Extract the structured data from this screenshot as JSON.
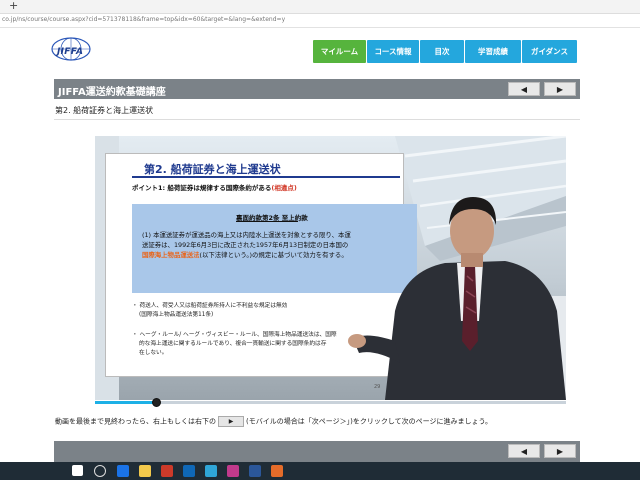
{
  "browser": {
    "new_tab_symbol": "+",
    "url": "co.jp/ns/course/course.aspx?cid=571378118&frame=top&idx=60&target=&lang=&extend=y"
  },
  "logo": {
    "text": "JIFFA"
  },
  "nav": [
    {
      "label": "マイルーム",
      "color": "#56b43d"
    },
    {
      "label": "コース情報",
      "color": "#24a7dd"
    },
    {
      "label": "目次",
      "color": "#24a7dd"
    },
    {
      "label": "学習成績",
      "color": "#24a7dd"
    },
    {
      "label": "ガイダンス",
      "color": "#24a7dd"
    }
  ],
  "course": {
    "title": "JIFFA運送約款基礎講座",
    "prev": "◀",
    "next": "▶"
  },
  "section": {
    "subtitle": "第2. 船荷証券と海上運送状"
  },
  "slide": {
    "heading": "第2. 船荷証券と海上運送状",
    "point_prefix": "ポイント1: 船荷証券は規律する国際条約がある",
    "point_emphasis": "(相違点)",
    "box_heading": "裏面約款第2条 至上約款",
    "box_line1": "(1) 本運送証券が運送品の海上又は内陸水上運送を対象とする限り、本運",
    "box_line2": "送証券は、1992年6月3日に改正された1957年6月13日制定の日本国の",
    "box_line3_orange": "国際海上物品運送法",
    "box_line3_rest": "(以下法律という。)の規定に基づいて効力を有する。",
    "bullet1_line1": "・ 荷送人、荷受人又は船荷証券所持人に不利益な規定は無効",
    "bullet1_line2": "(国際海上物品運送法第11条)",
    "bullet2_line1": "・ ヘーグ・ルール/ ヘーグ・ヴィスビー・ルール、国際海上物品運送法は、国際",
    "bullet2_line2": "的な海上運送に関するルールであり、複合一貫輸送に関する国際条約は存",
    "bullet2_line3": "在しない。",
    "page_number": "29"
  },
  "video": {
    "progress_fraction": 0.13
  },
  "instruction": {
    "before": "動画を最後まで見終わったら、右上もしくは右下の",
    "button": "▶",
    "after": "(モバイルの場合は「次ページ＞」)をクリックして次のページに進みましょう。"
  },
  "colors": {
    "nav_green": "#56b43d",
    "nav_blue": "#24a7dd",
    "title_bar": "#7b8288",
    "progress_fill": "#1db0e6",
    "taskbar": "#1f2c36"
  }
}
